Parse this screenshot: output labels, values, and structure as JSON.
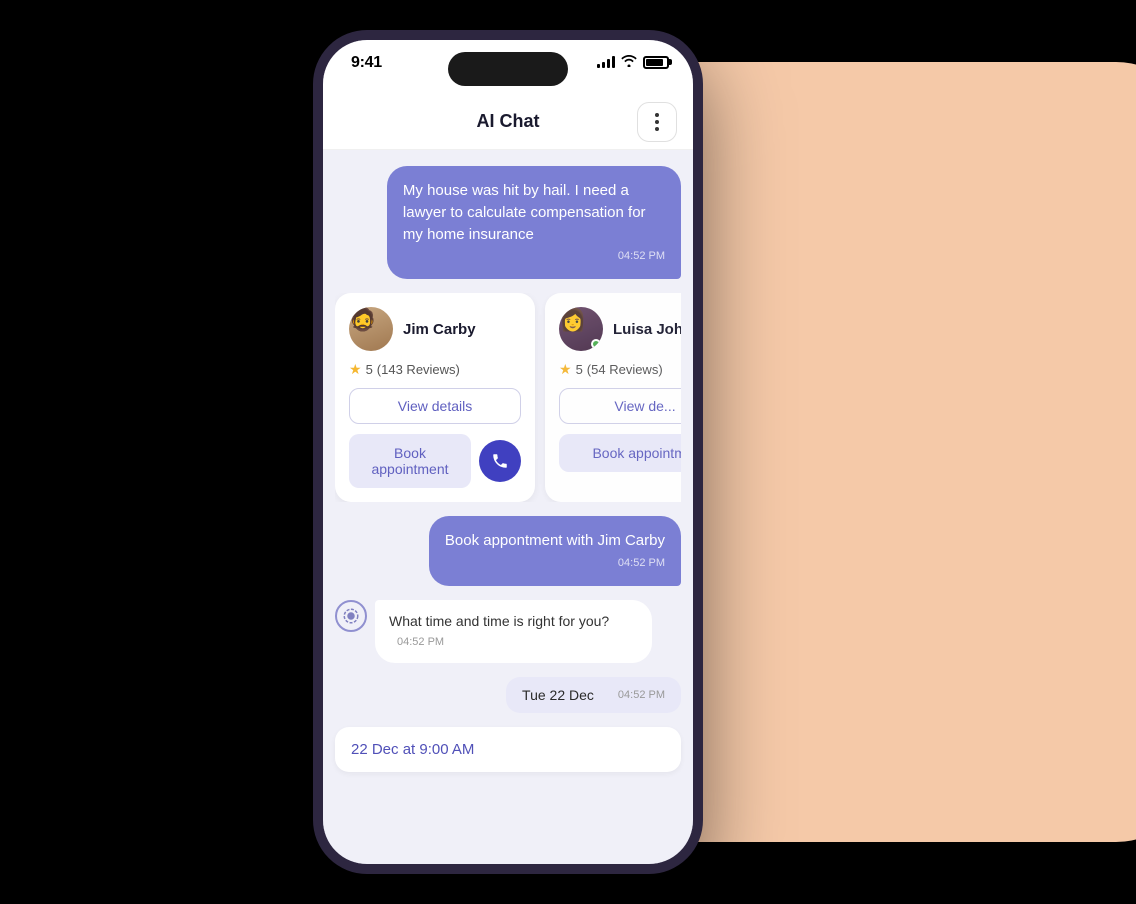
{
  "background": {
    "blob_color": "#f5c9a8"
  },
  "status_bar": {
    "time": "9:41",
    "signal": "signal",
    "wifi": "wifi",
    "battery": "battery"
  },
  "header": {
    "title": "AI Chat",
    "menu_label": "more options"
  },
  "chat": {
    "user_message": {
      "text": "My house was hit by hail. I need a lawyer to calculate compensation for my home insurance",
      "time": "04:52 PM"
    },
    "lawyer_cards": [
      {
        "name": "Jim Carby",
        "rating": "5",
        "reviews": "(143 Reviews)",
        "view_details_label": "View details",
        "book_appointment_label": "Book appointment",
        "has_phone": true,
        "online": false
      },
      {
        "name": "Luisa Johns",
        "rating": "5",
        "reviews": "(54 Reviews)",
        "view_details_label": "View de...",
        "book_appointment_label": "Book appointm...",
        "has_phone": false,
        "online": true
      }
    ],
    "book_confirm_message": {
      "text": "Book appontment with Jim Carby",
      "time": "04:52 PM"
    },
    "ai_message": {
      "text": "What time and time is right for you?",
      "time": "04:52 PM"
    },
    "date_bubble": {
      "text": "Tue 22 Dec",
      "time": "04:52 PM"
    },
    "time_slot": {
      "text": "22 Dec at 9:00 AM"
    }
  }
}
